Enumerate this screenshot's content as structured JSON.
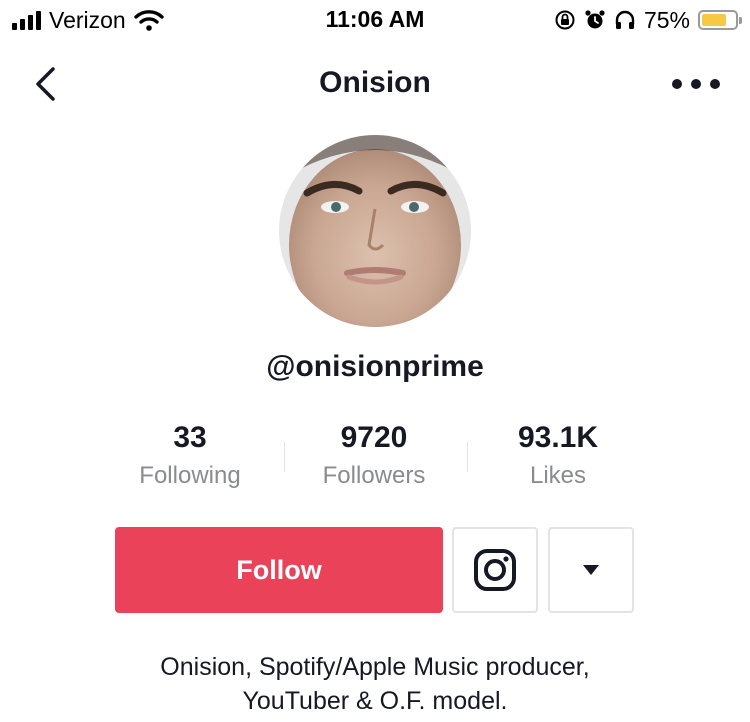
{
  "status_bar": {
    "carrier": "Verizon",
    "time": "11:06 AM",
    "battery_percent": "75%",
    "battery_level": 0.75,
    "icons": [
      "signal-icon",
      "wifi-icon",
      "orientation-lock-icon",
      "alarm-icon",
      "headphones-icon",
      "battery-icon"
    ]
  },
  "nav": {
    "title": "Onision",
    "back_icon": "chevron-left-icon",
    "more_icon": "more-horizontal-icon"
  },
  "profile": {
    "username": "@onisionprime",
    "stats": [
      {
        "value": "33",
        "label": "Following"
      },
      {
        "value": "9720",
        "label": "Followers"
      },
      {
        "value": "93.1K",
        "label": "Likes"
      }
    ],
    "follow_label": "Follow",
    "instagram_icon": "instagram-icon",
    "dropdown_icon": "caret-down-icon",
    "bio_line1": "Onision, Spotify/Apple Music producer,",
    "bio_line2": "YouTuber & O.F. model."
  },
  "colors": {
    "accent": "#ea4359",
    "text": "#161823",
    "muted": "#8a8b91",
    "battery": "#f6c945"
  }
}
